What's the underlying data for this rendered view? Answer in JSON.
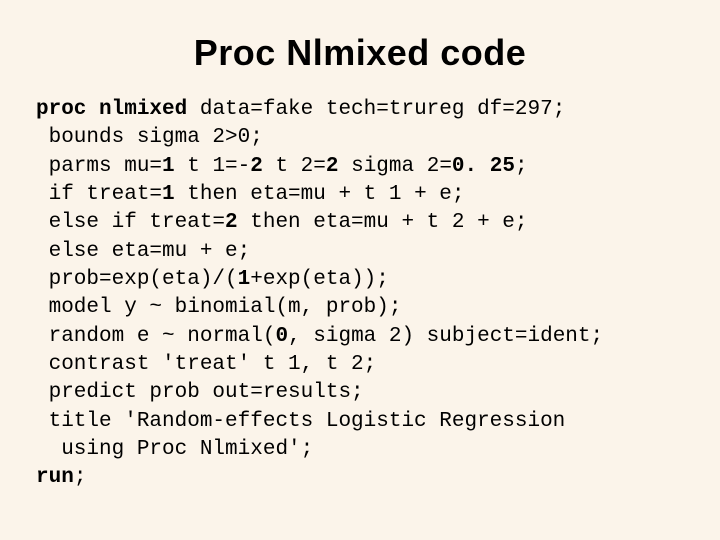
{
  "title": "Proc Nlmixed code",
  "code": {
    "kw_proc": "proc nlmixed",
    "l1_rest": " data=fake tech=trureg df=297;",
    "l2": " bounds sigma 2>0;",
    "l3_a": " parms mu=",
    "l3_b": "1",
    "l3_c": " t 1=-",
    "l3_d": "2",
    "l3_e": " t 2=",
    "l3_f": "2",
    "l3_g": " sigma 2=",
    "l3_h": "0. 25",
    "l3_i": ";",
    "l4_a": " if treat=",
    "l4_b": "1",
    "l4_c": " then eta=mu + t 1 + e;",
    "l5_a": " else if treat=",
    "l5_b": "2",
    "l5_c": " then eta=mu + t 2 + e;",
    "l6": " else eta=mu + e;",
    "l7_a": " prob=exp(eta)/(",
    "l7_b": "1",
    "l7_c": "+exp(eta));",
    "l8": " model y ~ binomial(m, prob);",
    "l9_a": " random e ~ normal(",
    "l9_b": "0",
    "l9_c": ", sigma 2) subject=ident;",
    "l10": " contrast 'treat' t 1, t 2;",
    "l11": " predict prob out=results;",
    "l12a": " title 'Random-effects Logistic Regression",
    "l12b": "  using Proc Nlmixed';",
    "kw_run": "run",
    "run_semi": ";"
  }
}
